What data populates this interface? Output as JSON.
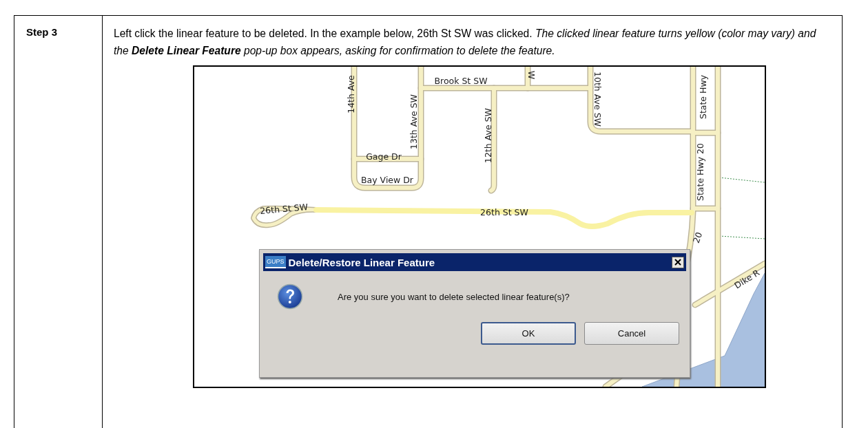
{
  "step": {
    "label": "Step 3",
    "instruction": "Left click the linear feature to be deleted. In the example below, 26th St SW was clicked. *The clicked linear feature turns yellow (color may vary) and the* **Delete Linear Feature** *pop-up box appears, asking for confirmation to delete the feature.*"
  },
  "map": {
    "labels": [
      {
        "text": "14th Ave"
      },
      {
        "text": "Brook St SW"
      },
      {
        "text": "W"
      },
      {
        "text": "10th Ave SW"
      },
      {
        "text": "State Hwy"
      },
      {
        "text": "13th Ave SW"
      },
      {
        "text": "12th Ave SW"
      },
      {
        "text": "Gage Dr"
      },
      {
        "text": "Bay View Dr"
      },
      {
        "text": "State Hwy 20"
      },
      {
        "text": "26th St SW"
      },
      {
        "text": "26th St SW"
      },
      {
        "text": "20"
      },
      {
        "text": "Dike R"
      }
    ]
  },
  "dialog": {
    "title": "Delete/Restore Linear Feature",
    "app_badge": "GUPS",
    "message": "Are you sure you want to delete selected linear feature(s)?",
    "buttons": [
      {
        "label": "OK",
        "default": true
      },
      {
        "label": "Cancel",
        "default": false
      }
    ]
  }
}
